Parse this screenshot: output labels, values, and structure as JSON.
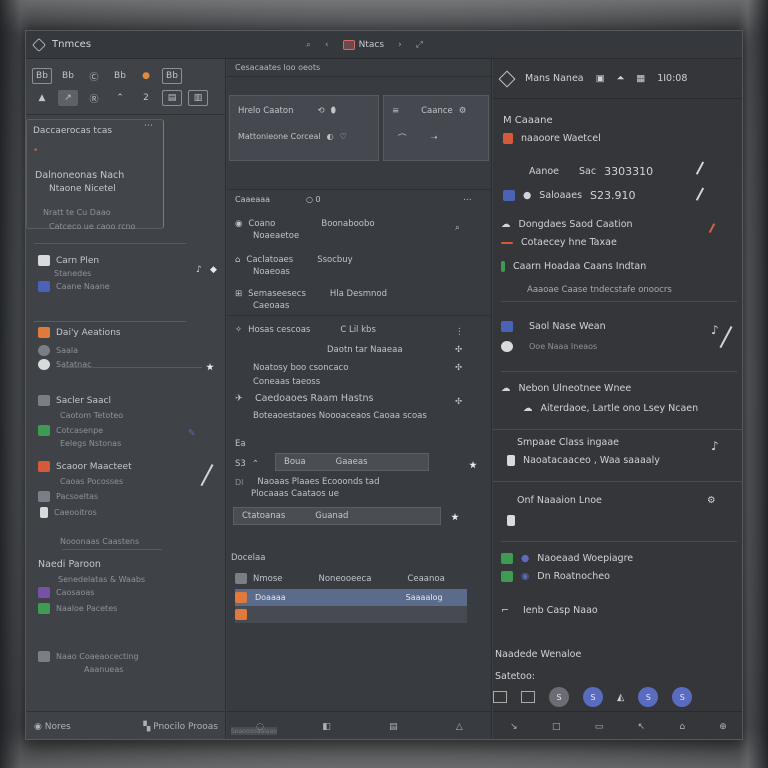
{
  "window": {
    "title": "Tnmces",
    "tab_label": "Ntacs"
  },
  "left": {
    "toolbar_row1": [
      "Bb",
      "Bb",
      "Ⓒ",
      "Bb",
      "●",
      "Bb"
    ],
    "toolbar_row2": [
      "▲",
      "↗",
      "Ⓡ",
      "⌃",
      "2",
      "▤",
      "▥"
    ],
    "card1_title": "Daccaerocas tcas",
    "card2_title": "Dalnoneonas Nach",
    "card2_sub1": "Ntaone Nicetel",
    "card2_sub2": "Nratt te Cu Daao",
    "card2_sub3": "Catceco ue caoo rcno",
    "cue_title": "Carn Plen",
    "cue_sub1": "Stanedes",
    "cue_sub2": "Caane Naane",
    "item_a": "Dai'y Aeations",
    "item_b": "Saala",
    "item_c": "Satatnac",
    "item_d": "Sacler Saacl",
    "item_d_sub": "Caotom Tetoteo",
    "item_e1": "Cotcasenpe",
    "item_e2": "Eelegs Nstonas",
    "item_f": "Scaoor Maacteet",
    "item_f_sub": "Caoas Pocosses",
    "item_g": "Pacsoeltas",
    "item_h1": "Caeooitros",
    "item_h2": "Nooonaas Caastens",
    "group_title": "Naedi Paroon",
    "group_sub": "Senedelatas & Waabs",
    "group_i1": "Caosaoas",
    "group_i2": "Naaloe Pacetes",
    "group_i3": "Naao Coaeaocecting",
    "group_i3_sub": "Aaanueas",
    "footer_left": "Nores",
    "footer_right": "Pnocilo Prooas"
  },
  "center": {
    "header": "Cesacaates loo oeots",
    "card_title_a": "Hrelo Caaton",
    "card_title_b": "Caance",
    "card_body": "Mattonieone Corceal",
    "section1_title": "Caaeaaa",
    "section1_count": "○ 0",
    "section1_r1a": "Coano",
    "section1_r1b": "Noaeaetoe",
    "section1_r1c": "Boonaboobo",
    "section1_r2a": "Caclatoaes",
    "section1_r2b": "Noaeoas",
    "section1_r2c": "Ssocbuy",
    "section1_r3a": "Semaseesecs",
    "section1_r3b": "Hla Desmnod",
    "section1_r3c": "Caeoaas",
    "section1_r4a": "Hosas cescoas",
    "section1_r4b": "C Lil kbs",
    "section1_r5": "Daotn tar Naaeaa",
    "section1_r6": "Noatosy boo csoncaco",
    "section1_r7": "Coneaas taeoss",
    "big_row": "Caedoaoes Raam Hastns",
    "big_row_sub": "Boteaoestaoes Noooaceaos Caoaa scoas",
    "meta1": "Ea",
    "field1_a": "Boua",
    "field1_b": "Gaaeas",
    "meta2": "Dl",
    "meta2_text": "Naoaas Plaaes Ecooonds tad",
    "meta3_text": "Plocaaas Caataos ue",
    "field2_a": "Ctatoanas",
    "field2_b": "Guanad",
    "list_title": "Docelaa",
    "list_h_a": "Nmose",
    "list_h_b": "Noneooeeca",
    "list_h_c": "Ceaanoa",
    "list_sel_a": "Doaaaa",
    "list_sel_b": "Saaaalog",
    "bottom_strip": "Soaooooaalaao"
  },
  "right": {
    "head_title": "Mans Nanea",
    "head_value": "1I0:08",
    "title": "M Caaane",
    "sub_item": "naaoore Waetcel",
    "stat1_label": "Aanoe",
    "stat1_label2": "Sac",
    "stat1_value": "3303310",
    "stat2_label": "Saloaaes",
    "stat2_value": "S23.910",
    "group1_a": "Dongdaes Saod Caation",
    "group1_b": "Cotaecey hne Taxae",
    "group2_a": "Caarn Hoadaa Caans Indtan",
    "group2_b": "Aaaoae Caase tndecstafe onoocrs",
    "group3_a": "Saol Nase Wean",
    "group3_b": "Ooe Naaa Ineaos",
    "group4_a": "Nebon Ulneotnee Wnee",
    "group4_b": "Aiterdaoe, Lartle ono Lsey Ncaen",
    "group5_a": "Smpaae Class ingaae",
    "group5_b": "Naoatacaaceo , Waa saaaaly",
    "group6": "Onf Naaaion Lnoe",
    "task_a": "Naoeaad Woepiagre",
    "task_b": "Dn Roatnocheo",
    "task_c": "Ienb Casp Naao",
    "section_title": "Naadede Wenaloe",
    "section_label": "Satetoo:",
    "footer_btns": [
      "S",
      "S",
      "S",
      "S"
    ],
    "footer_icons": [
      "↘",
      "□",
      "▭",
      "↖",
      "⌂",
      "⊕"
    ]
  },
  "colors": {
    "window_bg": "#3d4045",
    "accent_blue": "#5a6cc0",
    "accent_orange": "#e07a3a",
    "accent_red": "#d65a3a",
    "accent_green": "#3f9a52",
    "selection": "#5a6b8c"
  }
}
